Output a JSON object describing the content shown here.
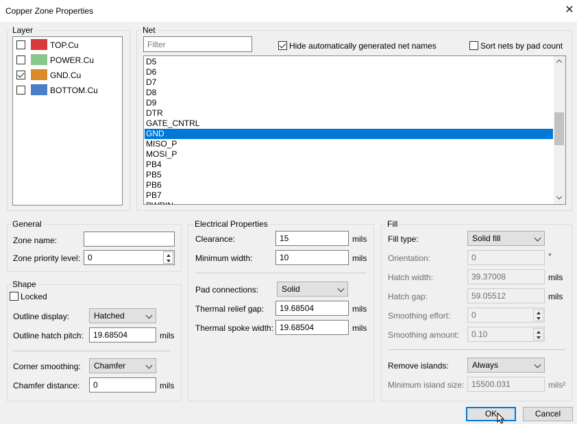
{
  "window": {
    "title": "Copper Zone Properties",
    "close_glyph": "✕"
  },
  "layer": {
    "label": "Layer",
    "items": [
      {
        "name": "TOP.Cu",
        "color": "#d63a3a",
        "checked": false
      },
      {
        "name": "POWER.Cu",
        "color": "#86c98b",
        "checked": false
      },
      {
        "name": "GND.Cu",
        "color": "#d98a2b",
        "checked": true
      },
      {
        "name": "BOTTOM.Cu",
        "color": "#4a7fc8",
        "checked": false
      }
    ]
  },
  "net": {
    "label": "Net",
    "filter_placeholder": "Filter",
    "hide_auto_label": "Hide automatically generated net names",
    "hide_auto_checked": true,
    "sort_by_pad_label": "Sort nets by pad count",
    "sort_by_pad_checked": false,
    "items": [
      "D5",
      "D6",
      "D7",
      "D8",
      "D9",
      "DTR",
      "GATE_CNTRL",
      "GND",
      "MISO_P",
      "MOSI_P",
      "PB4",
      "PB5",
      "PB6",
      "PB7"
    ],
    "selected": "GND",
    "partial_item": "PWRIN"
  },
  "general": {
    "label": "General",
    "zone_name_label": "Zone name:",
    "zone_name_value": "",
    "priority_label": "Zone priority level:",
    "priority_value": "0"
  },
  "shape": {
    "label": "Shape",
    "locked_label": "Locked",
    "outline_display_label": "Outline display:",
    "outline_display_value": "Hatched",
    "hatch_pitch_label": "Outline hatch pitch:",
    "hatch_pitch_value": "19.68504",
    "hatch_pitch_unit": "mils",
    "corner_smoothing_label": "Corner smoothing:",
    "corner_smoothing_value": "Chamfer",
    "chamfer_distance_label": "Chamfer distance:",
    "chamfer_distance_value": "0",
    "chamfer_distance_unit": "mils"
  },
  "electrical": {
    "label": "Electrical Properties",
    "clearance_label": "Clearance:",
    "clearance_value": "15",
    "clearance_unit": "mils",
    "min_width_label": "Minimum width:",
    "min_width_value": "10",
    "min_width_unit": "mils",
    "pad_conn_label": "Pad connections:",
    "pad_conn_value": "Solid",
    "relief_gap_label": "Thermal relief gap:",
    "relief_gap_value": "19.68504",
    "relief_gap_unit": "mils",
    "spoke_width_label": "Thermal spoke width:",
    "spoke_width_value": "19.68504",
    "spoke_width_unit": "mils"
  },
  "fill": {
    "label": "Fill",
    "fill_type_label": "Fill type:",
    "fill_type_value": "Solid fill",
    "orientation_label": "Orientation:",
    "orientation_value": "0",
    "orientation_unit": "°",
    "hatch_width_label": "Hatch width:",
    "hatch_width_value": "39.37008",
    "hatch_width_unit": "mils",
    "hatch_gap_label": "Hatch gap:",
    "hatch_gap_value": "59.05512",
    "hatch_gap_unit": "mils",
    "smoothing_effort_label": "Smoothing effort:",
    "smoothing_effort_value": "0",
    "smoothing_amount_label": "Smoothing amount:",
    "smoothing_amount_value": "0.10",
    "remove_islands_label": "Remove islands:",
    "remove_islands_value": "Always",
    "min_island_label": "Minimum island size:",
    "min_island_value": "15500.031",
    "min_island_unit": "mils²"
  },
  "buttons": {
    "ok": "OK",
    "cancel": "Cancel"
  }
}
